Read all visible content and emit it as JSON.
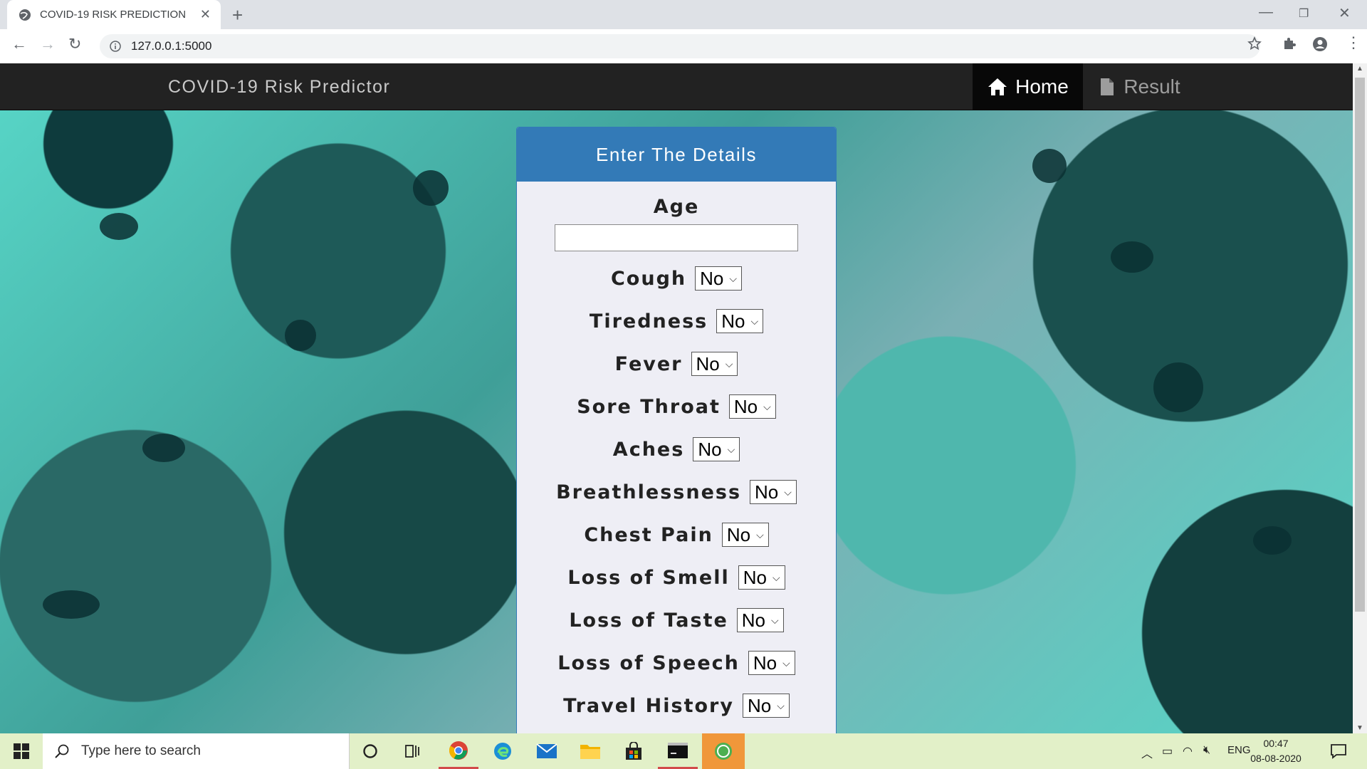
{
  "browser": {
    "tab_title": "COVID-19 RISK PREDICTION",
    "url": "127.0.0.1:5000",
    "new_tab": "+",
    "close": "✕"
  },
  "navbar": {
    "brand": "COVID-19 Risk Predictor",
    "home_label": "Home",
    "result_label": "Result"
  },
  "form": {
    "heading": "Enter The Details",
    "age_label": "Age",
    "age_value": "",
    "fields": [
      {
        "label": "Cough",
        "value": "No"
      },
      {
        "label": "Tiredness",
        "value": "No"
      },
      {
        "label": "Fever",
        "value": "No"
      },
      {
        "label": "Sore Throat",
        "value": "No"
      },
      {
        "label": "Aches",
        "value": "No"
      },
      {
        "label": "Breathlessness",
        "value": "No"
      },
      {
        "label": "Chest Pain",
        "value": "No"
      },
      {
        "label": "Loss of Smell",
        "value": "No"
      },
      {
        "label": "Loss of Taste",
        "value": "No"
      },
      {
        "label": "Loss of Speech",
        "value": "No"
      },
      {
        "label": "Travel History",
        "value": "No"
      }
    ]
  },
  "taskbar": {
    "search_placeholder": "Type here to search",
    "language": "ENG",
    "time": "00:47",
    "date": "08-08-2020"
  },
  "colors": {
    "navbar_bg": "#222222",
    "panel_heading": "#337ab7",
    "panel_bg": "#eeeef5",
    "taskbar_bg": "#e2f0c8"
  }
}
